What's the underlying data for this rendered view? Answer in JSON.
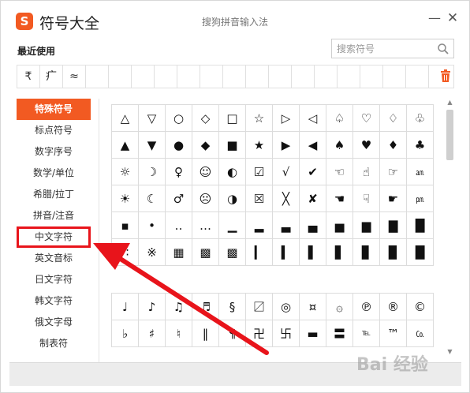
{
  "window": {
    "logo": "S",
    "title": "符号大全",
    "ime_name": "搜狗拼音输入法",
    "minimize": "—",
    "close": "✕"
  },
  "recent": {
    "label": "最近使用",
    "symbols": [
      "₹",
      "疒",
      "≈",
      "",
      "",
      "",
      "",
      "",
      "",
      "",
      "",
      "",
      "",
      "",
      "",
      "",
      "",
      ""
    ]
  },
  "search": {
    "placeholder": "搜索符号"
  },
  "sidebar": {
    "items": [
      {
        "label": "特殊符号",
        "state": "active"
      },
      {
        "label": "标点符号",
        "state": ""
      },
      {
        "label": "数字序号",
        "state": ""
      },
      {
        "label": "数学/单位",
        "state": ""
      },
      {
        "label": "希腊/拉丁",
        "state": ""
      },
      {
        "label": "拼音/注音",
        "state": ""
      },
      {
        "label": "中文字符",
        "state": "highlighted"
      },
      {
        "label": "英文音标",
        "state": ""
      },
      {
        "label": "日文字符",
        "state": ""
      },
      {
        "label": "韩文字符",
        "state": ""
      },
      {
        "label": "俄文字母",
        "state": ""
      },
      {
        "label": "制表符",
        "state": ""
      }
    ]
  },
  "grid1": [
    "△",
    "▽",
    "○",
    "◇",
    "□",
    "☆",
    "▷",
    "◁",
    "♤",
    "♡",
    "♢",
    "♧",
    "▲",
    "▼",
    "●",
    "◆",
    "■",
    "★",
    "▶",
    "◀",
    "♠",
    "♥",
    "♦",
    "♣",
    "☼",
    "☽",
    "♀",
    "☺",
    "◐",
    "☑",
    "√",
    "✔",
    "☜",
    "☝",
    "☞",
    "㏂",
    "☀",
    "☾",
    "♂",
    "☹",
    "◑",
    "☒",
    "╳",
    "✘",
    "☚",
    "☟",
    "☛",
    "㏘",
    "▪",
    "•",
    "‥",
    "…",
    "▁",
    "▂",
    "▃",
    "▄",
    "▅",
    "▆",
    "▇",
    "█",
    "∷",
    "※",
    "▦",
    "▩",
    "▩",
    "▎",
    "▍",
    "▌",
    "▋",
    "▊",
    "▉",
    "█"
  ],
  "grid2": [
    "♩",
    "♪",
    "♫",
    "♬",
    "§",
    "〼",
    "◎",
    "¤",
    "۞",
    "℗",
    "®",
    "©",
    "♭",
    "♯",
    "♮",
    "‖",
    "¶",
    "卍",
    "卐",
    "▬",
    "〓",
    "℡",
    "™",
    "㏇"
  ],
  "watermark": "Bai 经验",
  "colors": {
    "accent": "#f25a22",
    "highlight_box": "#e8141b",
    "arrow": "#e8141b"
  }
}
